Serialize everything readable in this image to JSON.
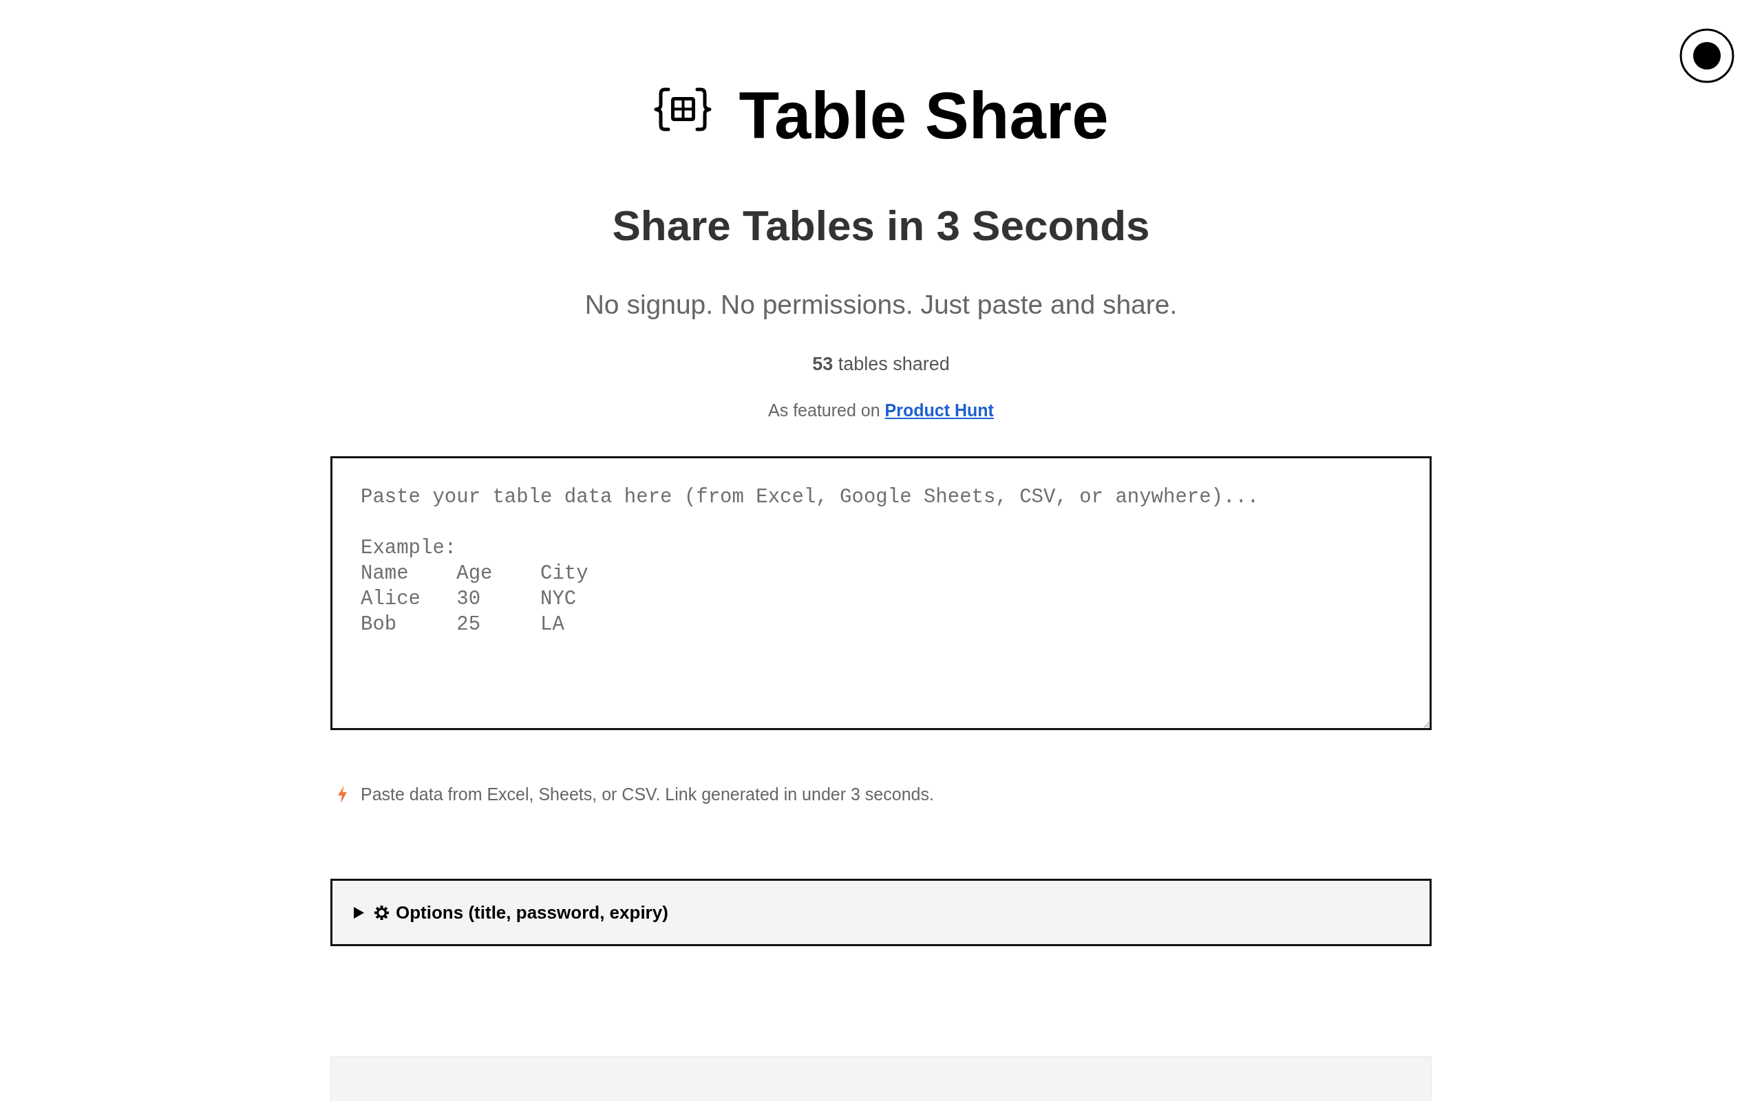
{
  "header": {
    "title": "Table Share"
  },
  "headline": "Share Tables in 3 Seconds",
  "tagline": "No signup. No permissions. Just paste and share.",
  "stats": {
    "text": "**53** tables shared"
  },
  "featured": {
    "text": "As featured on",
    "link": "Product Hunt"
  },
  "paste_box": {
    "placeholder": "Paste your table data here (from Excel, Google Sheets, CSV, or anywhere)...\n\nExample:\nName    Age    City\nAlice   30     NYC\nBob     25     LA"
  },
  "hint": {
    "text": "Paste data from Excel, Sheets, or CSV. Link generated in under 3 seconds."
  },
  "options": {
    "label": "Options (title, password, expiry)",
    "expanded": false
  }
}
